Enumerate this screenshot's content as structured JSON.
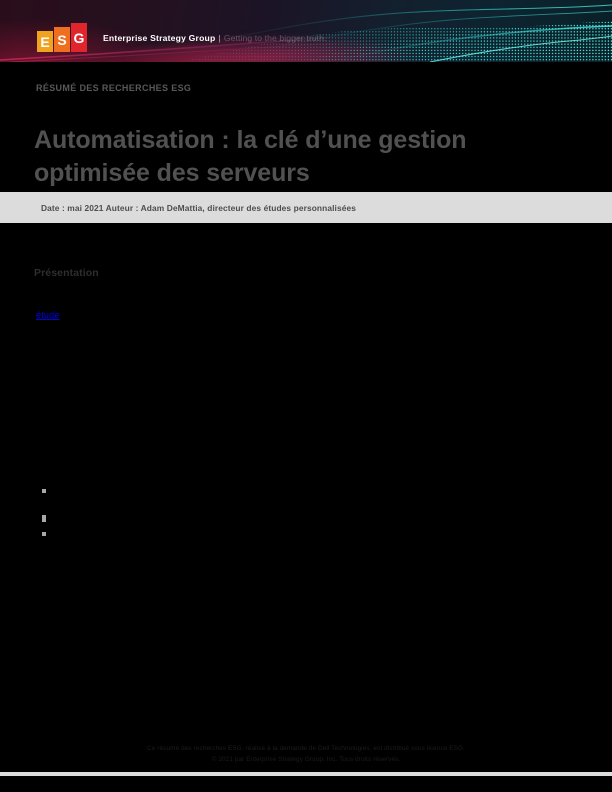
{
  "header": {
    "logo": {
      "tiles": [
        "E",
        "S",
        "G"
      ],
      "colors": [
        "#f0a31e",
        "#ef6f20",
        "#e0262c"
      ]
    },
    "brand_name": "Enterprise Strategy Group",
    "separator": "|",
    "tagline": "Getting to the bigger truth."
  },
  "document": {
    "eyebrow": "RÉSUMÉ DES RECHERCHES ESG",
    "title": "Automatisation : la clé d’une gestion optimisée des serveurs",
    "meta_bar": "Date : mai 2021 Auteur : Adam DeMattia, directeur des études personnalisées"
  },
  "body": {
    "section_heading": "Présentation",
    "paragraph_1": "",
    "link_text": "étude",
    "paragraph_2": "",
    "paragraph_3": "",
    "bullets": [
      {
        "text": ""
      },
      {
        "text": ""
      },
      {
        "text": ""
      },
      {
        "text": ""
      },
      {
        "text": ""
      }
    ]
  },
  "footer": {
    "line_1": "Ce résumé des recherches ESG, réalisé à la demande de Dell Technologies, est distribué sous licence ESG.",
    "line_2": "© 2021 par Enterprise Strategy Group, Inc. Tous droits réservés."
  },
  "colors": {
    "accent_cyan": "#2fe3d8",
    "accent_magenta": "#d6285c",
    "link_blue": "#0000ee",
    "bar_gray": "#dcdcdc",
    "title_gray": "#515151",
    "page_black": "#000000"
  }
}
